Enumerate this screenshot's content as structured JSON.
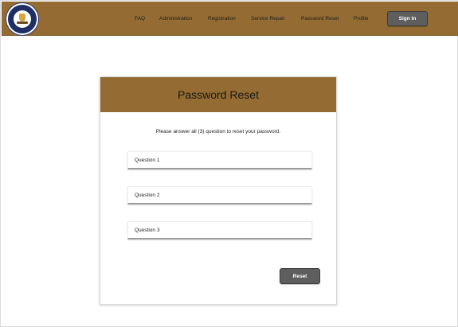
{
  "nav": {
    "items": [
      {
        "label": "FAQ"
      },
      {
        "label": "Administration"
      },
      {
        "label": "Registration"
      },
      {
        "label": "Service Repair"
      },
      {
        "label": "Password Reset"
      },
      {
        "label": "Profile"
      }
    ],
    "signin_label": "Sign In"
  },
  "card": {
    "title": "Password Reset",
    "instruction": "Please answer all (3) question to reset your password.",
    "fields": [
      {
        "label": "Question 1"
      },
      {
        "label": "Question 2"
      },
      {
        "label": "Question 3"
      }
    ],
    "reset_label": "Reset"
  },
  "colors": {
    "brand_brown": "#946b32",
    "button_gray": "#5e5e5e",
    "logo_navy": "#1f2f66"
  },
  "icons": {
    "logo": "logo-seal-icon"
  }
}
